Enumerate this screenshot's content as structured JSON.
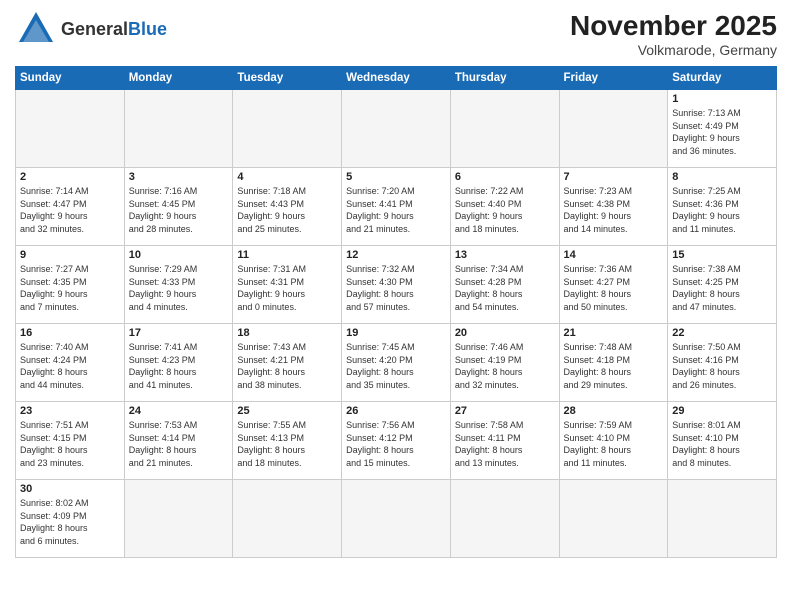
{
  "header": {
    "logo_general": "General",
    "logo_blue": "Blue",
    "month_title": "November 2025",
    "location": "Volkmarode, Germany"
  },
  "days_of_week": [
    "Sunday",
    "Monday",
    "Tuesday",
    "Wednesday",
    "Thursday",
    "Friday",
    "Saturday"
  ],
  "weeks": [
    [
      {
        "day": "",
        "info": ""
      },
      {
        "day": "",
        "info": ""
      },
      {
        "day": "",
        "info": ""
      },
      {
        "day": "",
        "info": ""
      },
      {
        "day": "",
        "info": ""
      },
      {
        "day": "",
        "info": ""
      },
      {
        "day": "1",
        "info": "Sunrise: 7:13 AM\nSunset: 4:49 PM\nDaylight: 9 hours\nand 36 minutes."
      }
    ],
    [
      {
        "day": "2",
        "info": "Sunrise: 7:14 AM\nSunset: 4:47 PM\nDaylight: 9 hours\nand 32 minutes."
      },
      {
        "day": "3",
        "info": "Sunrise: 7:16 AM\nSunset: 4:45 PM\nDaylight: 9 hours\nand 28 minutes."
      },
      {
        "day": "4",
        "info": "Sunrise: 7:18 AM\nSunset: 4:43 PM\nDaylight: 9 hours\nand 25 minutes."
      },
      {
        "day": "5",
        "info": "Sunrise: 7:20 AM\nSunset: 4:41 PM\nDaylight: 9 hours\nand 21 minutes."
      },
      {
        "day": "6",
        "info": "Sunrise: 7:22 AM\nSunset: 4:40 PM\nDaylight: 9 hours\nand 18 minutes."
      },
      {
        "day": "7",
        "info": "Sunrise: 7:23 AM\nSunset: 4:38 PM\nDaylight: 9 hours\nand 14 minutes."
      },
      {
        "day": "8",
        "info": "Sunrise: 7:25 AM\nSunset: 4:36 PM\nDaylight: 9 hours\nand 11 minutes."
      }
    ],
    [
      {
        "day": "9",
        "info": "Sunrise: 7:27 AM\nSunset: 4:35 PM\nDaylight: 9 hours\nand 7 minutes."
      },
      {
        "day": "10",
        "info": "Sunrise: 7:29 AM\nSunset: 4:33 PM\nDaylight: 9 hours\nand 4 minutes."
      },
      {
        "day": "11",
        "info": "Sunrise: 7:31 AM\nSunset: 4:31 PM\nDaylight: 9 hours\nand 0 minutes."
      },
      {
        "day": "12",
        "info": "Sunrise: 7:32 AM\nSunset: 4:30 PM\nDaylight: 8 hours\nand 57 minutes."
      },
      {
        "day": "13",
        "info": "Sunrise: 7:34 AM\nSunset: 4:28 PM\nDaylight: 8 hours\nand 54 minutes."
      },
      {
        "day": "14",
        "info": "Sunrise: 7:36 AM\nSunset: 4:27 PM\nDaylight: 8 hours\nand 50 minutes."
      },
      {
        "day": "15",
        "info": "Sunrise: 7:38 AM\nSunset: 4:25 PM\nDaylight: 8 hours\nand 47 minutes."
      }
    ],
    [
      {
        "day": "16",
        "info": "Sunrise: 7:40 AM\nSunset: 4:24 PM\nDaylight: 8 hours\nand 44 minutes."
      },
      {
        "day": "17",
        "info": "Sunrise: 7:41 AM\nSunset: 4:23 PM\nDaylight: 8 hours\nand 41 minutes."
      },
      {
        "day": "18",
        "info": "Sunrise: 7:43 AM\nSunset: 4:21 PM\nDaylight: 8 hours\nand 38 minutes."
      },
      {
        "day": "19",
        "info": "Sunrise: 7:45 AM\nSunset: 4:20 PM\nDaylight: 8 hours\nand 35 minutes."
      },
      {
        "day": "20",
        "info": "Sunrise: 7:46 AM\nSunset: 4:19 PM\nDaylight: 8 hours\nand 32 minutes."
      },
      {
        "day": "21",
        "info": "Sunrise: 7:48 AM\nSunset: 4:18 PM\nDaylight: 8 hours\nand 29 minutes."
      },
      {
        "day": "22",
        "info": "Sunrise: 7:50 AM\nSunset: 4:16 PM\nDaylight: 8 hours\nand 26 minutes."
      }
    ],
    [
      {
        "day": "23",
        "info": "Sunrise: 7:51 AM\nSunset: 4:15 PM\nDaylight: 8 hours\nand 23 minutes."
      },
      {
        "day": "24",
        "info": "Sunrise: 7:53 AM\nSunset: 4:14 PM\nDaylight: 8 hours\nand 21 minutes."
      },
      {
        "day": "25",
        "info": "Sunrise: 7:55 AM\nSunset: 4:13 PM\nDaylight: 8 hours\nand 18 minutes."
      },
      {
        "day": "26",
        "info": "Sunrise: 7:56 AM\nSunset: 4:12 PM\nDaylight: 8 hours\nand 15 minutes."
      },
      {
        "day": "27",
        "info": "Sunrise: 7:58 AM\nSunset: 4:11 PM\nDaylight: 8 hours\nand 13 minutes."
      },
      {
        "day": "28",
        "info": "Sunrise: 7:59 AM\nSunset: 4:10 PM\nDaylight: 8 hours\nand 11 minutes."
      },
      {
        "day": "29",
        "info": "Sunrise: 8:01 AM\nSunset: 4:10 PM\nDaylight: 8 hours\nand 8 minutes."
      }
    ],
    [
      {
        "day": "30",
        "info": "Sunrise: 8:02 AM\nSunset: 4:09 PM\nDaylight: 8 hours\nand 6 minutes."
      },
      {
        "day": "",
        "info": ""
      },
      {
        "day": "",
        "info": ""
      },
      {
        "day": "",
        "info": ""
      },
      {
        "day": "",
        "info": ""
      },
      {
        "day": "",
        "info": ""
      },
      {
        "day": "",
        "info": ""
      }
    ]
  ]
}
